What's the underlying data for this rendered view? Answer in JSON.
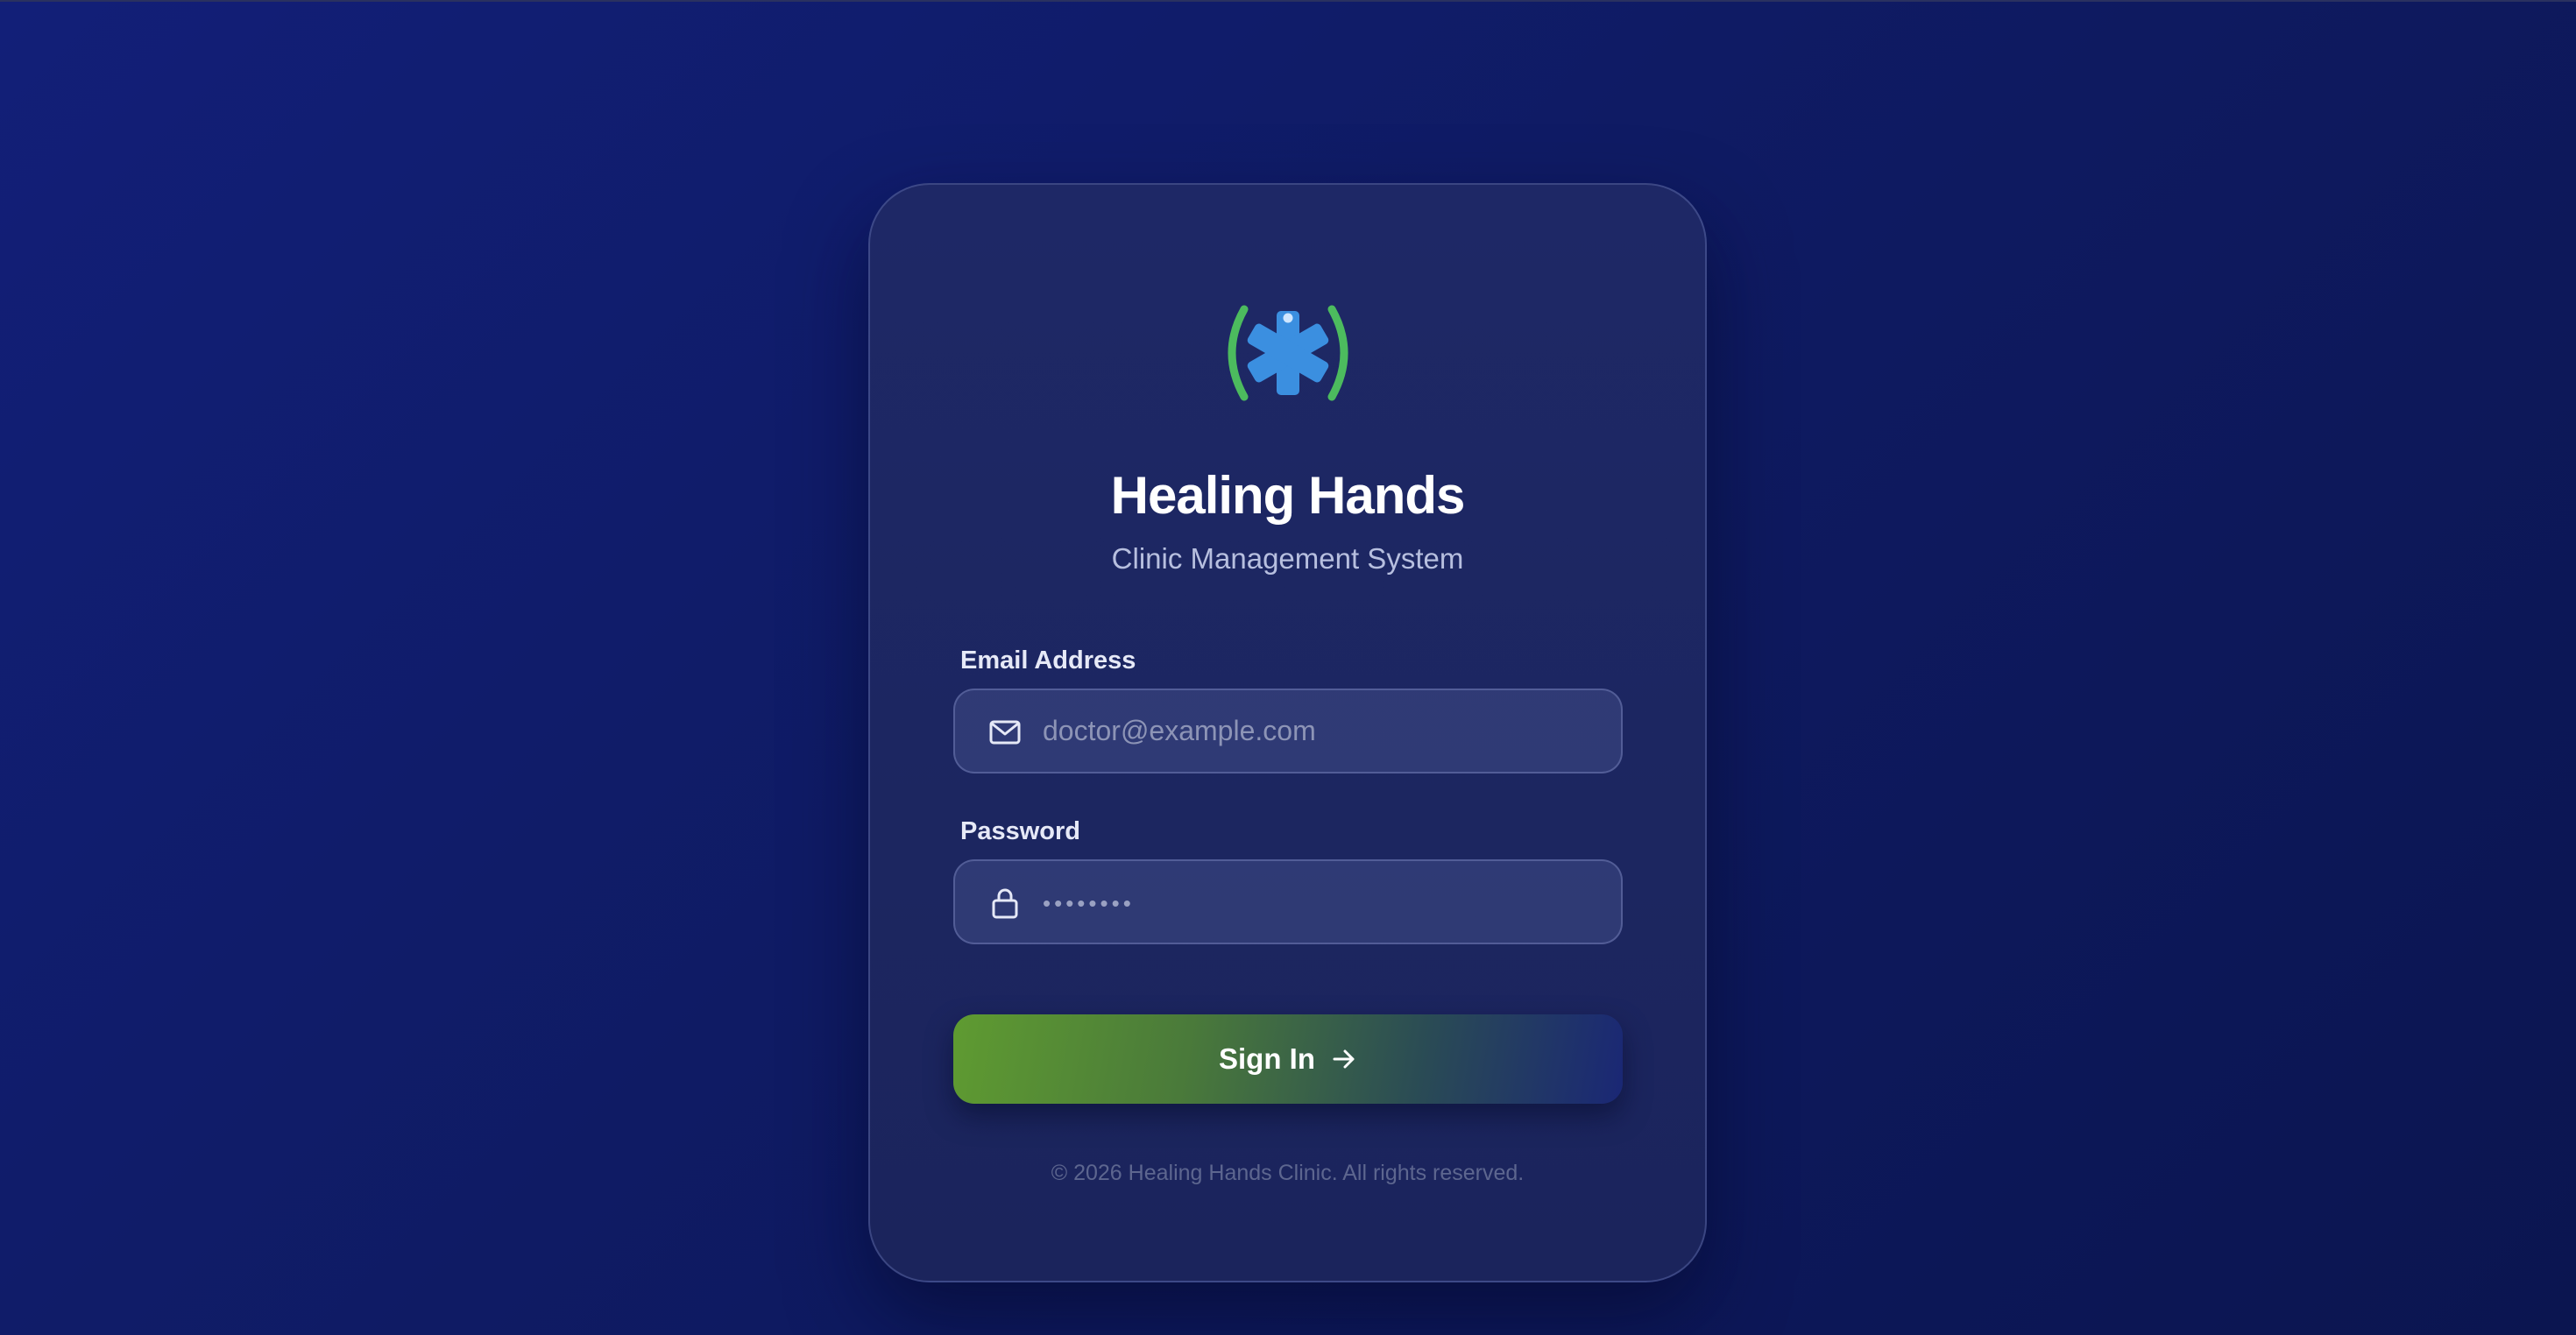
{
  "app": {
    "title": "Healing Hands",
    "subtitle": "Clinic Management System",
    "logo_icon": "medical-star-of-life-icon"
  },
  "form": {
    "email": {
      "label": "Email Address",
      "placeholder": "doctor@example.com",
      "value": "",
      "icon": "mail-icon"
    },
    "password": {
      "label": "Password",
      "placeholder": "••••••••",
      "value": "",
      "icon": "lock-icon"
    },
    "submit_label": "Sign In",
    "submit_icon": "arrow-right-icon"
  },
  "footer": {
    "copyright": "© 2026 Healing Hands Clinic. All rights reserved."
  },
  "colors": {
    "background": "#101c6a",
    "card": "#1e2866",
    "logo_blue": "#3b8fe0",
    "logo_green": "#4cbb5e",
    "button_start": "#5f9b31",
    "button_end": "#1a2775"
  }
}
